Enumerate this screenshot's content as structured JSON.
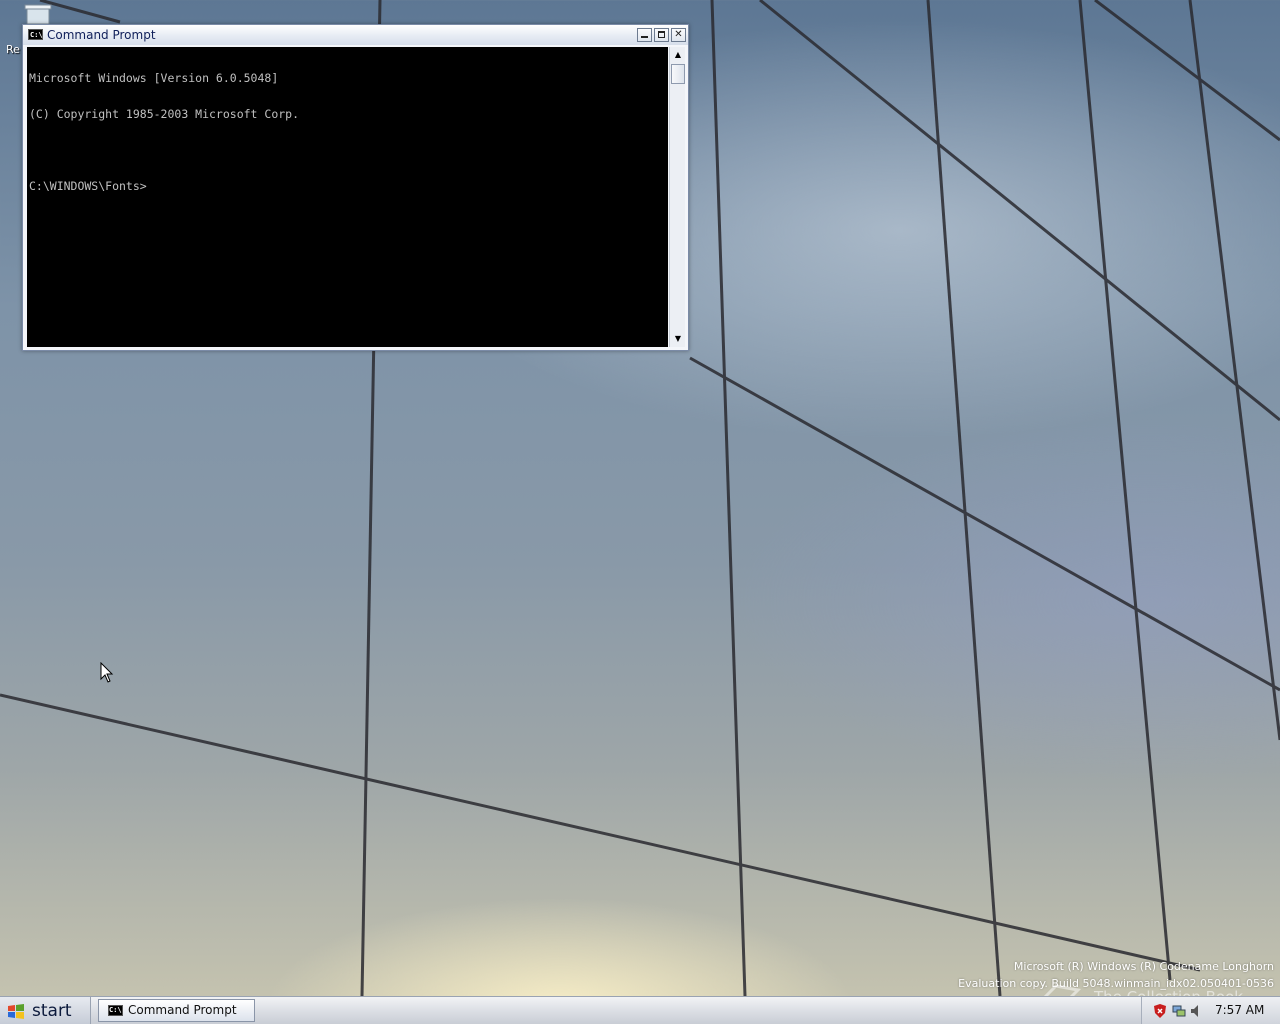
{
  "desktop": {
    "icon_label": "Re",
    "watermark_line1": "Microsoft (R) Windows (R) Codename Longhorn",
    "watermark_line2": "Evaluation copy. Build 5048.winmain_idx02.050401-0536",
    "logo_text": "The Collection Book"
  },
  "window": {
    "title": "Command Prompt",
    "icon_text": "C:\\",
    "console_lines": [
      "Microsoft Windows [Version 6.0.5048]",
      "(C) Copyright 1985-2003 Microsoft Corp.",
      "",
      "C:\\WINDOWS\\Fonts>"
    ],
    "scroll_up": "▲",
    "scroll_down": "▼",
    "close_glyph": "✕"
  },
  "taskbar": {
    "start_label": "start",
    "task_label": "Command Prompt",
    "task_icon_text": "C:\\",
    "clock": "7:57 AM"
  },
  "icons": {
    "recycle_bin": "recycle-bin-icon",
    "window": "command-prompt-icon",
    "start": "windows-flag-icon",
    "tray": [
      "security-shield-icon",
      "network-icon",
      "volume-icon"
    ],
    "cursor": "mouse-pointer-icon"
  },
  "colors": {
    "console_background": "#000000",
    "console_text": "#c0c0c0",
    "title_text": "#10205a"
  }
}
